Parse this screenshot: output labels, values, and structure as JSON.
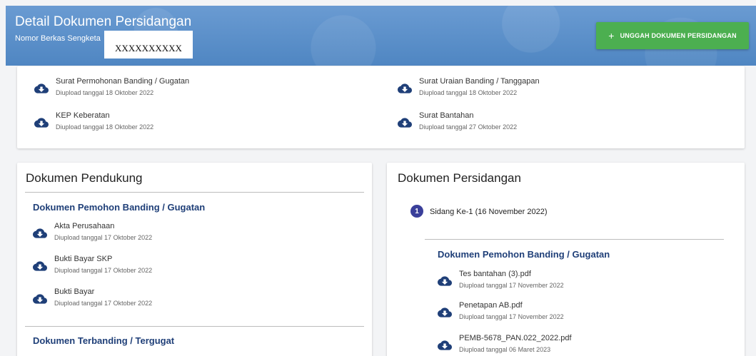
{
  "header": {
    "title": "Detail Dokumen Persidangan",
    "subtitle": "Nomor Berkas Sengketa",
    "case_number": "XXXXXXXXXX",
    "upload_button_label": "UNGGAH DOKUMEN PERSIDANGAN",
    "upload_button_icon": "+",
    "accent_color": "#4caf50",
    "banner_color": "#5b8fc9"
  },
  "top_documents": [
    {
      "name": "Surat Permohonan Banding / Gugatan",
      "date": "Diupload tanggal 18 Oktober 2022",
      "icon": "cloud-download-icon"
    },
    {
      "name": "KEP Keberatan",
      "date": "Diupload tanggal 18 Oktober 2022",
      "icon": "cloud-download-icon"
    },
    {
      "name": "Surat Uraian Banding / Tanggapan",
      "date": "Diupload tanggal 18 Oktober 2022",
      "icon": "cloud-download-icon"
    },
    {
      "name": "Surat Bantahan",
      "date": "Diupload tanggal 27 Oktober 2022",
      "icon": "cloud-download-icon"
    }
  ],
  "pendukung": {
    "title": "Dokumen Pendukung",
    "groups": [
      {
        "heading": "Dokumen Pemohon Banding / Gugatan",
        "items": [
          {
            "name": "Akta Perusahaan",
            "date": "Diupload tanggal 17 Oktober 2022"
          },
          {
            "name": "Bukti Bayar SKP",
            "date": "Diupload tanggal 17 Oktober 2022"
          },
          {
            "name": "Bukti Bayar",
            "date": "Diupload tanggal 17 Oktober 2022"
          }
        ]
      },
      {
        "heading": "Dokumen Terbanding / Tergugat",
        "items": []
      }
    ]
  },
  "persidangan": {
    "title": "Dokumen Persidangan",
    "sessions": [
      {
        "number": "1",
        "label": "Sidang Ke-1 (16 November 2022)",
        "heading": "Dokumen Pemohon Banding / Gugatan",
        "items": [
          {
            "name": "Tes bantahan (3).pdf",
            "date": "Diupload tanggal 17 November 2022"
          },
          {
            "name": "Penetapan AB.pdf",
            "date": "Diupload tanggal 17 November 2022"
          },
          {
            "name": "PEMB-5678_PAN.022_2022.pdf",
            "date": "Diupload tanggal 06 Maret 2023"
          }
        ]
      }
    ]
  }
}
